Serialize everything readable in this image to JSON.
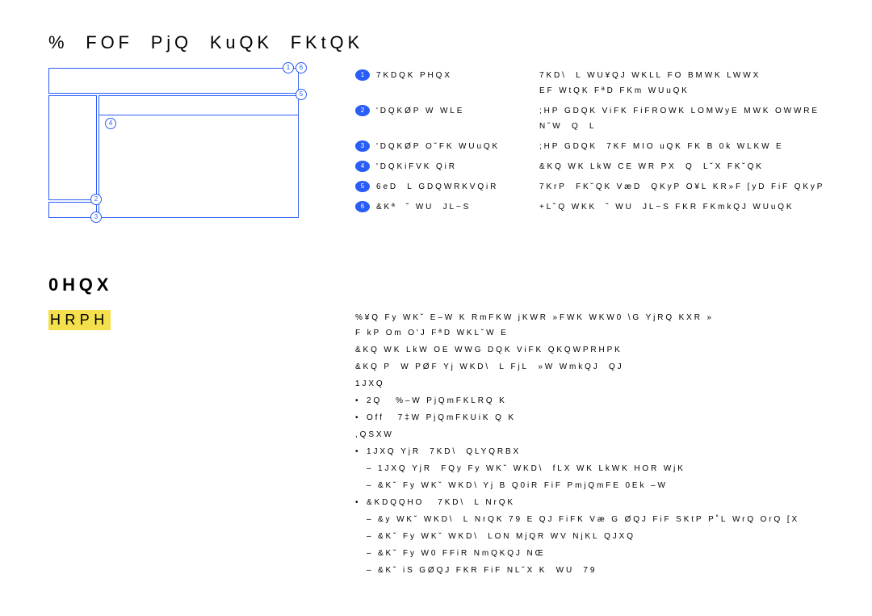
{
  "title": "%  FOF  PjQ  KuQK  FKtQK",
  "legend": [
    {
      "n": "1",
      "label": "7KDQK PHQX",
      "desc": "7KD\\  L WU¥QJ WKLL FO BMWK LWWX EF WtQK FªD FKm WUuQK"
    },
    {
      "n": "2",
      "label": "'DQKØP W WLE",
      "desc": ";HP GDQK ViFK FiFROWK LOMWyE MWK OWWRE N˘W  Q  L"
    },
    {
      "n": "3",
      "label": "'DQKØP O˘FK WUuQK",
      "desc": ";HP GDQK  7KF MIO uQK FK B 0k WLKW E"
    },
    {
      "n": "4",
      "label": "'DQKiFVK QiR",
      "desc": "&KQ WK LkW CE WR PX  Q  L˘X FK˘QK"
    },
    {
      "n": "5",
      "label": "6eD  L GDQWRKVQiR",
      "desc": "7KrP  FK˘QK VæD  QKyP O¥L KR»F [yD FiF QKyP"
    },
    {
      "n": "6",
      "label": "&Kª  ˘ WU  JL~S",
      "desc": "+L˘Q WKK  ˘ WU  JL~S FKR FKmkQJ WUuQK"
    }
  ],
  "section": "0HQX",
  "home": "HRPH",
  "body": [
    {
      "t": "p",
      "v": "%¥Q Fy WK˘ E–W K RmFKW jKWR »FWK WKW0 \\G YjRQ KXR » F kP Om O'J FªD WKL˘W E"
    },
    {
      "t": "p",
      "v": "&KQ WK LkW OE WWG DQK ViFK QKQWPRHPK"
    },
    {
      "t": "p",
      "v": "&KQ P  W PØF Yj WKD\\  L FjL  »W WmkQJ  QJ"
    },
    {
      "t": "p",
      "v": "1JXQ"
    },
    {
      "t": "bullet",
      "v": "2Q   %–W PjQmFKLRQ K"
    },
    {
      "t": "bullet",
      "v": "Off   7‡W PjQmFKUiK Q K"
    },
    {
      "t": "p",
      "v": ",QSXW"
    },
    {
      "t": "bullet",
      "v": "1JXQ YjR  7KD\\  QLYQRBX"
    },
    {
      "t": "dash",
      "v": "1JXQ YjR  FQy Fy WK˘ WKD\\  fLX WK LkWK HOR WjK"
    },
    {
      "t": "dash",
      "v": "&K˘ Fy WK˘ WKD\\ Yj B Q0iR FiF PmjQmFE 0Ek –W"
    },
    {
      "t": "bullet",
      "v": "&KDQQHO   7KD\\  L NrQK"
    },
    {
      "t": "dash",
      "v": "&y WK˘ WKD\\  L NrQK 79 E QJ FiFK Væ G ØQJ FiF SKtP P˚L WrQ OrQ [X"
    },
    {
      "t": "dash",
      "v": "&K˘ Fy WK˘ WKD\\  LON MjQR WV NjKL QJXQ"
    },
    {
      "t": "dash",
      "v": "&K˘ Fy W0 FFiR NmQKQJ NŒ"
    },
    {
      "t": "dash",
      "v": "&K˘ iS GØQJ FKR FiF NL˘X K  WU  79"
    }
  ]
}
